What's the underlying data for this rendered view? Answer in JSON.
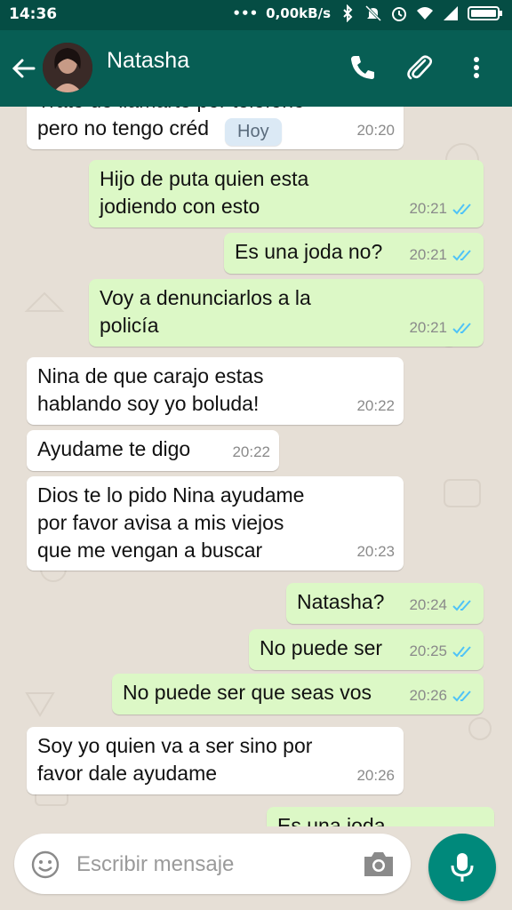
{
  "status_bar": {
    "time": "14:36",
    "network_speed": "0,00kB/s"
  },
  "header": {
    "contact_name": "Natasha"
  },
  "date_chip": "Hoy",
  "messages": [
    {
      "direction": "in",
      "text": "Trato de llamarte por teléfono\npero no tengo créd",
      "time": "20:20"
    },
    {
      "direction": "out",
      "text": "Hijo de puta quien esta\njodiendo con esto",
      "time": "20:21"
    },
    {
      "direction": "out",
      "text": "Es una joda no?",
      "time": "20:21"
    },
    {
      "direction": "out",
      "text": "Voy a denunciarlos a la\npolicía",
      "time": "20:21"
    },
    {
      "direction": "in",
      "text": "Nina de que carajo estas\nhablando soy yo boluda!",
      "time": "20:22"
    },
    {
      "direction": "in",
      "text": "Ayudame te digo",
      "time": "20:22"
    },
    {
      "direction": "in",
      "text": "Dios te lo pido Nina ayudame\npor favor avisa a mis viejos\nque me vengan a buscar",
      "time": "20:23"
    },
    {
      "direction": "out",
      "text": "Natasha?",
      "time": "20:24"
    },
    {
      "direction": "out",
      "text": "No puede ser",
      "time": "20:25"
    },
    {
      "direction": "out",
      "text": "No puede ser que seas vos",
      "time": "20:26"
    },
    {
      "direction": "in",
      "text": "Soy yo quien va a ser sino por\nfavor dale ayudame",
      "time": "20:26"
    },
    {
      "direction": "out",
      "text": "Es una joda",
      "time": ""
    }
  ],
  "composer": {
    "placeholder": "Escribir mensaje"
  },
  "colors": {
    "header": "#075e54",
    "status_bar": "#054d44",
    "outgoing": "#dcf8c6",
    "incoming": "#ffffff",
    "accent": "#00897b",
    "ticks": "#4fc3f7"
  },
  "icons": [
    "back-arrow-icon",
    "phone-icon",
    "attach-icon",
    "more-vert-icon",
    "emoji-icon",
    "camera-icon",
    "mic-icon",
    "read-ticks-icon",
    "bluetooth-icon",
    "mute-icon",
    "alarm-icon",
    "wifi-icon",
    "signal-icon",
    "battery-icon"
  ]
}
